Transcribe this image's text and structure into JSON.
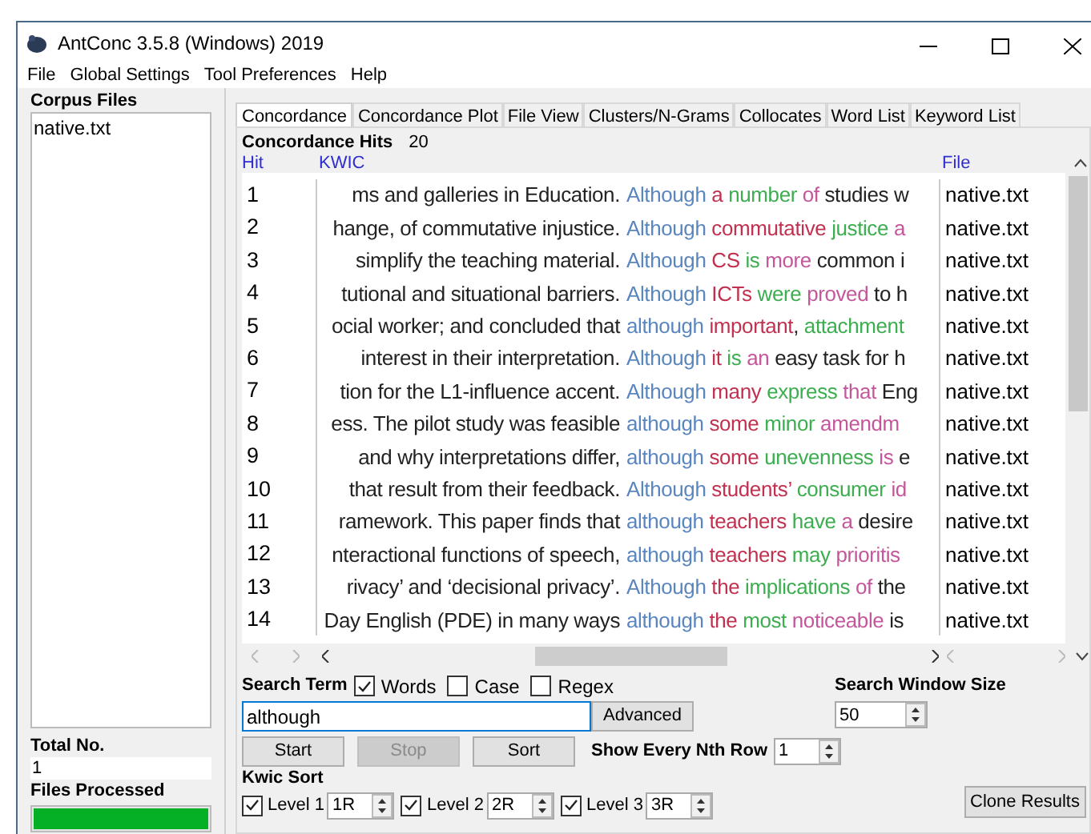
{
  "window": {
    "title": "AntConc 3.5.8 (Windows) 2019"
  },
  "menu": [
    "File",
    "Global Settings",
    "Tool Preferences",
    "Help"
  ],
  "corpus_files": {
    "title": "Corpus Files",
    "files": [
      "native.txt"
    ]
  },
  "total_no": {
    "label": "Total No.",
    "value": "1"
  },
  "files_processed": {
    "label": "Files Processed",
    "level": 1
  },
  "tabs": [
    {
      "label": "Concordance",
      "selected": true
    },
    {
      "label": "Concordance Plot",
      "selected": false
    },
    {
      "label": "File View",
      "selected": false
    },
    {
      "label": "Clusters/N-Grams",
      "selected": false
    },
    {
      "label": "Collocates",
      "selected": false
    },
    {
      "label": "Word List",
      "selected": false
    },
    {
      "label": "Keyword List",
      "selected": false
    }
  ],
  "concordance_hits": {
    "label": "Concordance Hits",
    "value": "20"
  },
  "columns": [
    "Hit",
    "KWIC",
    "File"
  ],
  "rows": [
    {
      "hit": "1",
      "left": "ms and galleries in Education.",
      "key": "Although",
      "right": [
        {
          "text": "a",
          "kind": "r1"
        },
        {
          "text": " number",
          "kind": "r2"
        },
        {
          "text": " of",
          "kind": "r3"
        },
        {
          "text": " studies w",
          "kind": "plain"
        }
      ],
      "file": "native.txt"
    },
    {
      "hit": "2",
      "left": "hange, of commutative injustice.",
      "key": "Although",
      "right": [
        {
          "text": "commutative",
          "kind": "r1"
        },
        {
          "text": " justice",
          "kind": "r2"
        },
        {
          "text": " a",
          "kind": "r3"
        }
      ],
      "file": "native.txt"
    },
    {
      "hit": "3",
      "left": "simplify the teaching material.",
      "key": "Although",
      "right": [
        {
          "text": "CS",
          "kind": "r1"
        },
        {
          "text": " is",
          "kind": "r2"
        },
        {
          "text": " more",
          "kind": "r3"
        },
        {
          "text": " common i",
          "kind": "plain"
        }
      ],
      "file": "native.txt"
    },
    {
      "hit": "4",
      "left": "tutional and situational barriers.",
      "key": "Although",
      "right": [
        {
          "text": "ICTs",
          "kind": "r1"
        },
        {
          "text": " were",
          "kind": "r2"
        },
        {
          "text": " proved",
          "kind": "r3"
        },
        {
          "text": " to h",
          "kind": "plain"
        }
      ],
      "file": "native.txt"
    },
    {
      "hit": "5",
      "left": "ocial worker; and concluded that",
      "key": "although",
      "right": [
        {
          "text": "important",
          "kind": "r1"
        },
        {
          "text": ",",
          "kind": "plain"
        },
        {
          "text": " attachment",
          "kind": "r2"
        }
      ],
      "file": "native.txt"
    },
    {
      "hit": "6",
      "left": "interest in their interpretation.",
      "key": "Although",
      "right": [
        {
          "text": "it",
          "kind": "r1"
        },
        {
          "text": " is",
          "kind": "r2"
        },
        {
          "text": " an",
          "kind": "r3"
        },
        {
          "text": " easy task for h",
          "kind": "plain"
        }
      ],
      "file": "native.txt"
    },
    {
      "hit": "7",
      "left": "tion for the L1-influence accent.",
      "key": "Although",
      "right": [
        {
          "text": "many",
          "kind": "r1"
        },
        {
          "text": " express",
          "kind": "r2"
        },
        {
          "text": " that",
          "kind": "r3"
        },
        {
          "text": " Eng",
          "kind": "plain"
        }
      ],
      "file": "native.txt"
    },
    {
      "hit": "8",
      "left": "ess. The pilot study was feasible",
      "key": "although",
      "right": [
        {
          "text": "some",
          "kind": "r1"
        },
        {
          "text": " minor",
          "kind": "r2"
        },
        {
          "text": " amendm",
          "kind": "r3"
        }
      ],
      "file": "native.txt"
    },
    {
      "hit": "9",
      "left": "and why interpretations differ,",
      "key": "although",
      "right": [
        {
          "text": "some",
          "kind": "r1"
        },
        {
          "text": " unevenness",
          "kind": "r2"
        },
        {
          "text": " is",
          "kind": "r3"
        },
        {
          "text": " e",
          "kind": "plain"
        }
      ],
      "file": "native.txt"
    },
    {
      "hit": "10",
      "left": "that result from their feedback.",
      "key": "Although",
      "right": [
        {
          "text": "students’",
          "kind": "r1"
        },
        {
          "text": " consumer",
          "kind": "r2"
        },
        {
          "text": " id",
          "kind": "r3"
        }
      ],
      "file": "native.txt"
    },
    {
      "hit": "11",
      "left": "ramework. This paper finds that",
      "key": "although",
      "right": [
        {
          "text": "teachers",
          "kind": "r1"
        },
        {
          "text": " have",
          "kind": "r2"
        },
        {
          "text": " a",
          "kind": "r3"
        },
        {
          "text": " desire",
          "kind": "plain"
        }
      ],
      "file": "native.txt"
    },
    {
      "hit": "12",
      "left": "nteractional functions of speech,",
      "key": "although",
      "right": [
        {
          "text": "teachers",
          "kind": "r1"
        },
        {
          "text": " may",
          "kind": "r2"
        },
        {
          "text": " prioritis",
          "kind": "r3"
        }
      ],
      "file": "native.txt"
    },
    {
      "hit": "13",
      "left": "rivacy’ and ‘decisional privacy’.",
      "key": "Although",
      "right": [
        {
          "text": "the",
          "kind": "r1"
        },
        {
          "text": " implications",
          "kind": "r2"
        },
        {
          "text": " of",
          "kind": "r3"
        },
        {
          "text": " the",
          "kind": "plain"
        }
      ],
      "file": "native.txt"
    },
    {
      "hit": "14",
      "left": "Day English (PDE) in many ways",
      "key": "although",
      "right": [
        {
          "text": "the",
          "kind": "r1"
        },
        {
          "text": " most",
          "kind": "r2"
        },
        {
          "text": " noticeable",
          "kind": "r3"
        },
        {
          "text": " is",
          "kind": "plain"
        }
      ],
      "file": "native.txt"
    }
  ],
  "search_term": {
    "label": "Search Term",
    "options": [
      {
        "label": "Words",
        "checked": true
      },
      {
        "label": "Case",
        "checked": false
      },
      {
        "label": "Regex",
        "checked": false
      }
    ],
    "value": "although"
  },
  "advanced_button": "Advanced",
  "search_window_size": {
    "label": "Search Window Size",
    "value": "50"
  },
  "actions": [
    {
      "label": "Start",
      "disabled": false
    },
    {
      "label": "Stop",
      "disabled": true
    },
    {
      "label": "Sort",
      "disabled": false
    }
  ],
  "show_every_nth_row": {
    "label": "Show Every Nth Row",
    "value": "1"
  },
  "kwic_sort": {
    "label": "Kwic Sort",
    "levels": [
      {
        "label": "Level 1",
        "checked": true,
        "value": "1R"
      },
      {
        "label": "Level 2",
        "checked": true,
        "value": "2R"
      },
      {
        "label": "Level 3",
        "checked": true,
        "value": "3R"
      }
    ]
  },
  "clone_button": "Clone Results"
}
